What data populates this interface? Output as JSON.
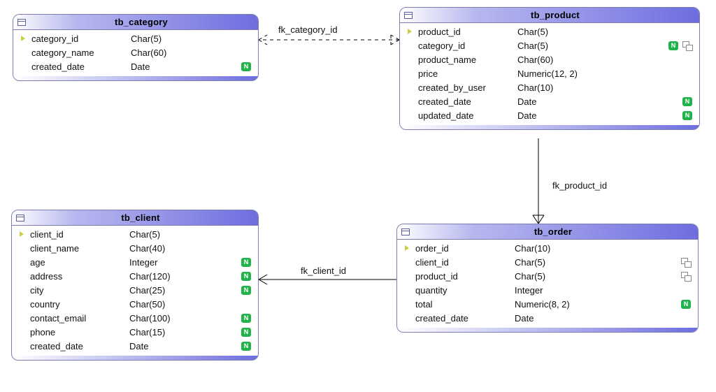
{
  "entities": {
    "category": {
      "title": "tb_category",
      "cols": [
        {
          "name": "category_id",
          "type": "Char(5)",
          "pk": true,
          "nullable": false,
          "fk": false
        },
        {
          "name": "category_name",
          "type": "Char(60)",
          "pk": false,
          "nullable": false,
          "fk": false
        },
        {
          "name": "created_date",
          "type": "Date",
          "pk": false,
          "nullable": true,
          "fk": false
        }
      ]
    },
    "product": {
      "title": "tb_product",
      "cols": [
        {
          "name": "product_id",
          "type": "Char(5)",
          "pk": true,
          "nullable": false,
          "fk": false
        },
        {
          "name": "category_id",
          "type": "Char(5)",
          "pk": false,
          "nullable": true,
          "fk": true
        },
        {
          "name": "product_name",
          "type": "Char(60)",
          "pk": false,
          "nullable": false,
          "fk": false
        },
        {
          "name": "price",
          "type": "Numeric(12, 2)",
          "pk": false,
          "nullable": false,
          "fk": false
        },
        {
          "name": "created_by_user",
          "type": "Char(10)",
          "pk": false,
          "nullable": false,
          "fk": false
        },
        {
          "name": "created_date",
          "type": "Date",
          "pk": false,
          "nullable": true,
          "fk": false
        },
        {
          "name": "updated_date",
          "type": "Date",
          "pk": false,
          "nullable": true,
          "fk": false
        }
      ]
    },
    "client": {
      "title": "tb_client",
      "cols": [
        {
          "name": "client_id",
          "type": "Char(5)",
          "pk": true,
          "nullable": false,
          "fk": false
        },
        {
          "name": "client_name",
          "type": "Char(40)",
          "pk": false,
          "nullable": false,
          "fk": false
        },
        {
          "name": "age",
          "type": "Integer",
          "pk": false,
          "nullable": true,
          "fk": false
        },
        {
          "name": "address",
          "type": "Char(120)",
          "pk": false,
          "nullable": true,
          "fk": false
        },
        {
          "name": "city",
          "type": "Char(25)",
          "pk": false,
          "nullable": true,
          "fk": false
        },
        {
          "name": "country",
          "type": "Char(50)",
          "pk": false,
          "nullable": false,
          "fk": false
        },
        {
          "name": "contact_email",
          "type": "Char(100)",
          "pk": false,
          "nullable": true,
          "fk": false
        },
        {
          "name": "phone",
          "type": "Char(15)",
          "pk": false,
          "nullable": true,
          "fk": false
        },
        {
          "name": "created_date",
          "type": "Date",
          "pk": false,
          "nullable": true,
          "fk": false
        }
      ]
    },
    "order": {
      "title": "tb_order",
      "cols": [
        {
          "name": "order_id",
          "type": "Char(10)",
          "pk": true,
          "nullable": false,
          "fk": false
        },
        {
          "name": "client_id",
          "type": "Char(5)",
          "pk": false,
          "nullable": false,
          "fk": true
        },
        {
          "name": "product_id",
          "type": "Char(5)",
          "pk": false,
          "nullable": false,
          "fk": true
        },
        {
          "name": "quantity",
          "type": "Integer",
          "pk": false,
          "nullable": false,
          "fk": false
        },
        {
          "name": "total",
          "type": "Numeric(8, 2)",
          "pk": false,
          "nullable": true,
          "fk": false
        },
        {
          "name": "created_date",
          "type": "Date",
          "pk": false,
          "nullable": false,
          "fk": false
        }
      ]
    }
  },
  "relationships": {
    "fk_category_id": "fk_category_id",
    "fk_product_id": "fk_product_id",
    "fk_client_id": "fk_client_id"
  },
  "chart_data": {
    "type": "table",
    "description": "Entity-relationship diagram with 4 tables and 3 foreign-key relationships.",
    "tables": [
      {
        "name": "tb_category",
        "columns": [
          {
            "name": "category_id",
            "type": "Char(5)",
            "pk": true,
            "nullable": false
          },
          {
            "name": "category_name",
            "type": "Char(60)",
            "pk": false,
            "nullable": false
          },
          {
            "name": "created_date",
            "type": "Date",
            "pk": false,
            "nullable": true
          }
        ]
      },
      {
        "name": "tb_product",
        "columns": [
          {
            "name": "product_id",
            "type": "Char(5)",
            "pk": true,
            "nullable": false
          },
          {
            "name": "category_id",
            "type": "Char(5)",
            "pk": false,
            "nullable": true,
            "fk": "tb_category.category_id"
          },
          {
            "name": "product_name",
            "type": "Char(60)",
            "pk": false,
            "nullable": false
          },
          {
            "name": "price",
            "type": "Numeric(12, 2)",
            "pk": false,
            "nullable": false
          },
          {
            "name": "created_by_user",
            "type": "Char(10)",
            "pk": false,
            "nullable": false
          },
          {
            "name": "created_date",
            "type": "Date",
            "pk": false,
            "nullable": true
          },
          {
            "name": "updated_date",
            "type": "Date",
            "pk": false,
            "nullable": true
          }
        ]
      },
      {
        "name": "tb_client",
        "columns": [
          {
            "name": "client_id",
            "type": "Char(5)",
            "pk": true,
            "nullable": false
          },
          {
            "name": "client_name",
            "type": "Char(40)",
            "pk": false,
            "nullable": false
          },
          {
            "name": "age",
            "type": "Integer",
            "pk": false,
            "nullable": true
          },
          {
            "name": "address",
            "type": "Char(120)",
            "pk": false,
            "nullable": true
          },
          {
            "name": "city",
            "type": "Char(25)",
            "pk": false,
            "nullable": true
          },
          {
            "name": "country",
            "type": "Char(50)",
            "pk": false,
            "nullable": false
          },
          {
            "name": "contact_email",
            "type": "Char(100)",
            "pk": false,
            "nullable": true
          },
          {
            "name": "phone",
            "type": "Char(15)",
            "pk": false,
            "nullable": true
          },
          {
            "name": "created_date",
            "type": "Date",
            "pk": false,
            "nullable": true
          }
        ]
      },
      {
        "name": "tb_order",
        "columns": [
          {
            "name": "order_id",
            "type": "Char(10)",
            "pk": true,
            "nullable": false
          },
          {
            "name": "client_id",
            "type": "Char(5)",
            "pk": false,
            "nullable": false,
            "fk": "tb_client.client_id"
          },
          {
            "name": "product_id",
            "type": "Char(5)",
            "pk": false,
            "nullable": false,
            "fk": "tb_product.product_id"
          },
          {
            "name": "quantity",
            "type": "Integer",
            "pk": false,
            "nullable": false
          },
          {
            "name": "total",
            "type": "Numeric(8, 2)",
            "pk": false,
            "nullable": true
          },
          {
            "name": "created_date",
            "type": "Date",
            "pk": false,
            "nullable": false
          }
        ]
      }
    ],
    "relationships": [
      {
        "name": "fk_category_id",
        "from": "tb_product.category_id",
        "to": "tb_category.category_id",
        "style": "dashed"
      },
      {
        "name": "fk_product_id",
        "from": "tb_order.product_id",
        "to": "tb_product.product_id",
        "style": "solid"
      },
      {
        "name": "fk_client_id",
        "from": "tb_order.client_id",
        "to": "tb_client.client_id",
        "style": "solid"
      }
    ]
  }
}
